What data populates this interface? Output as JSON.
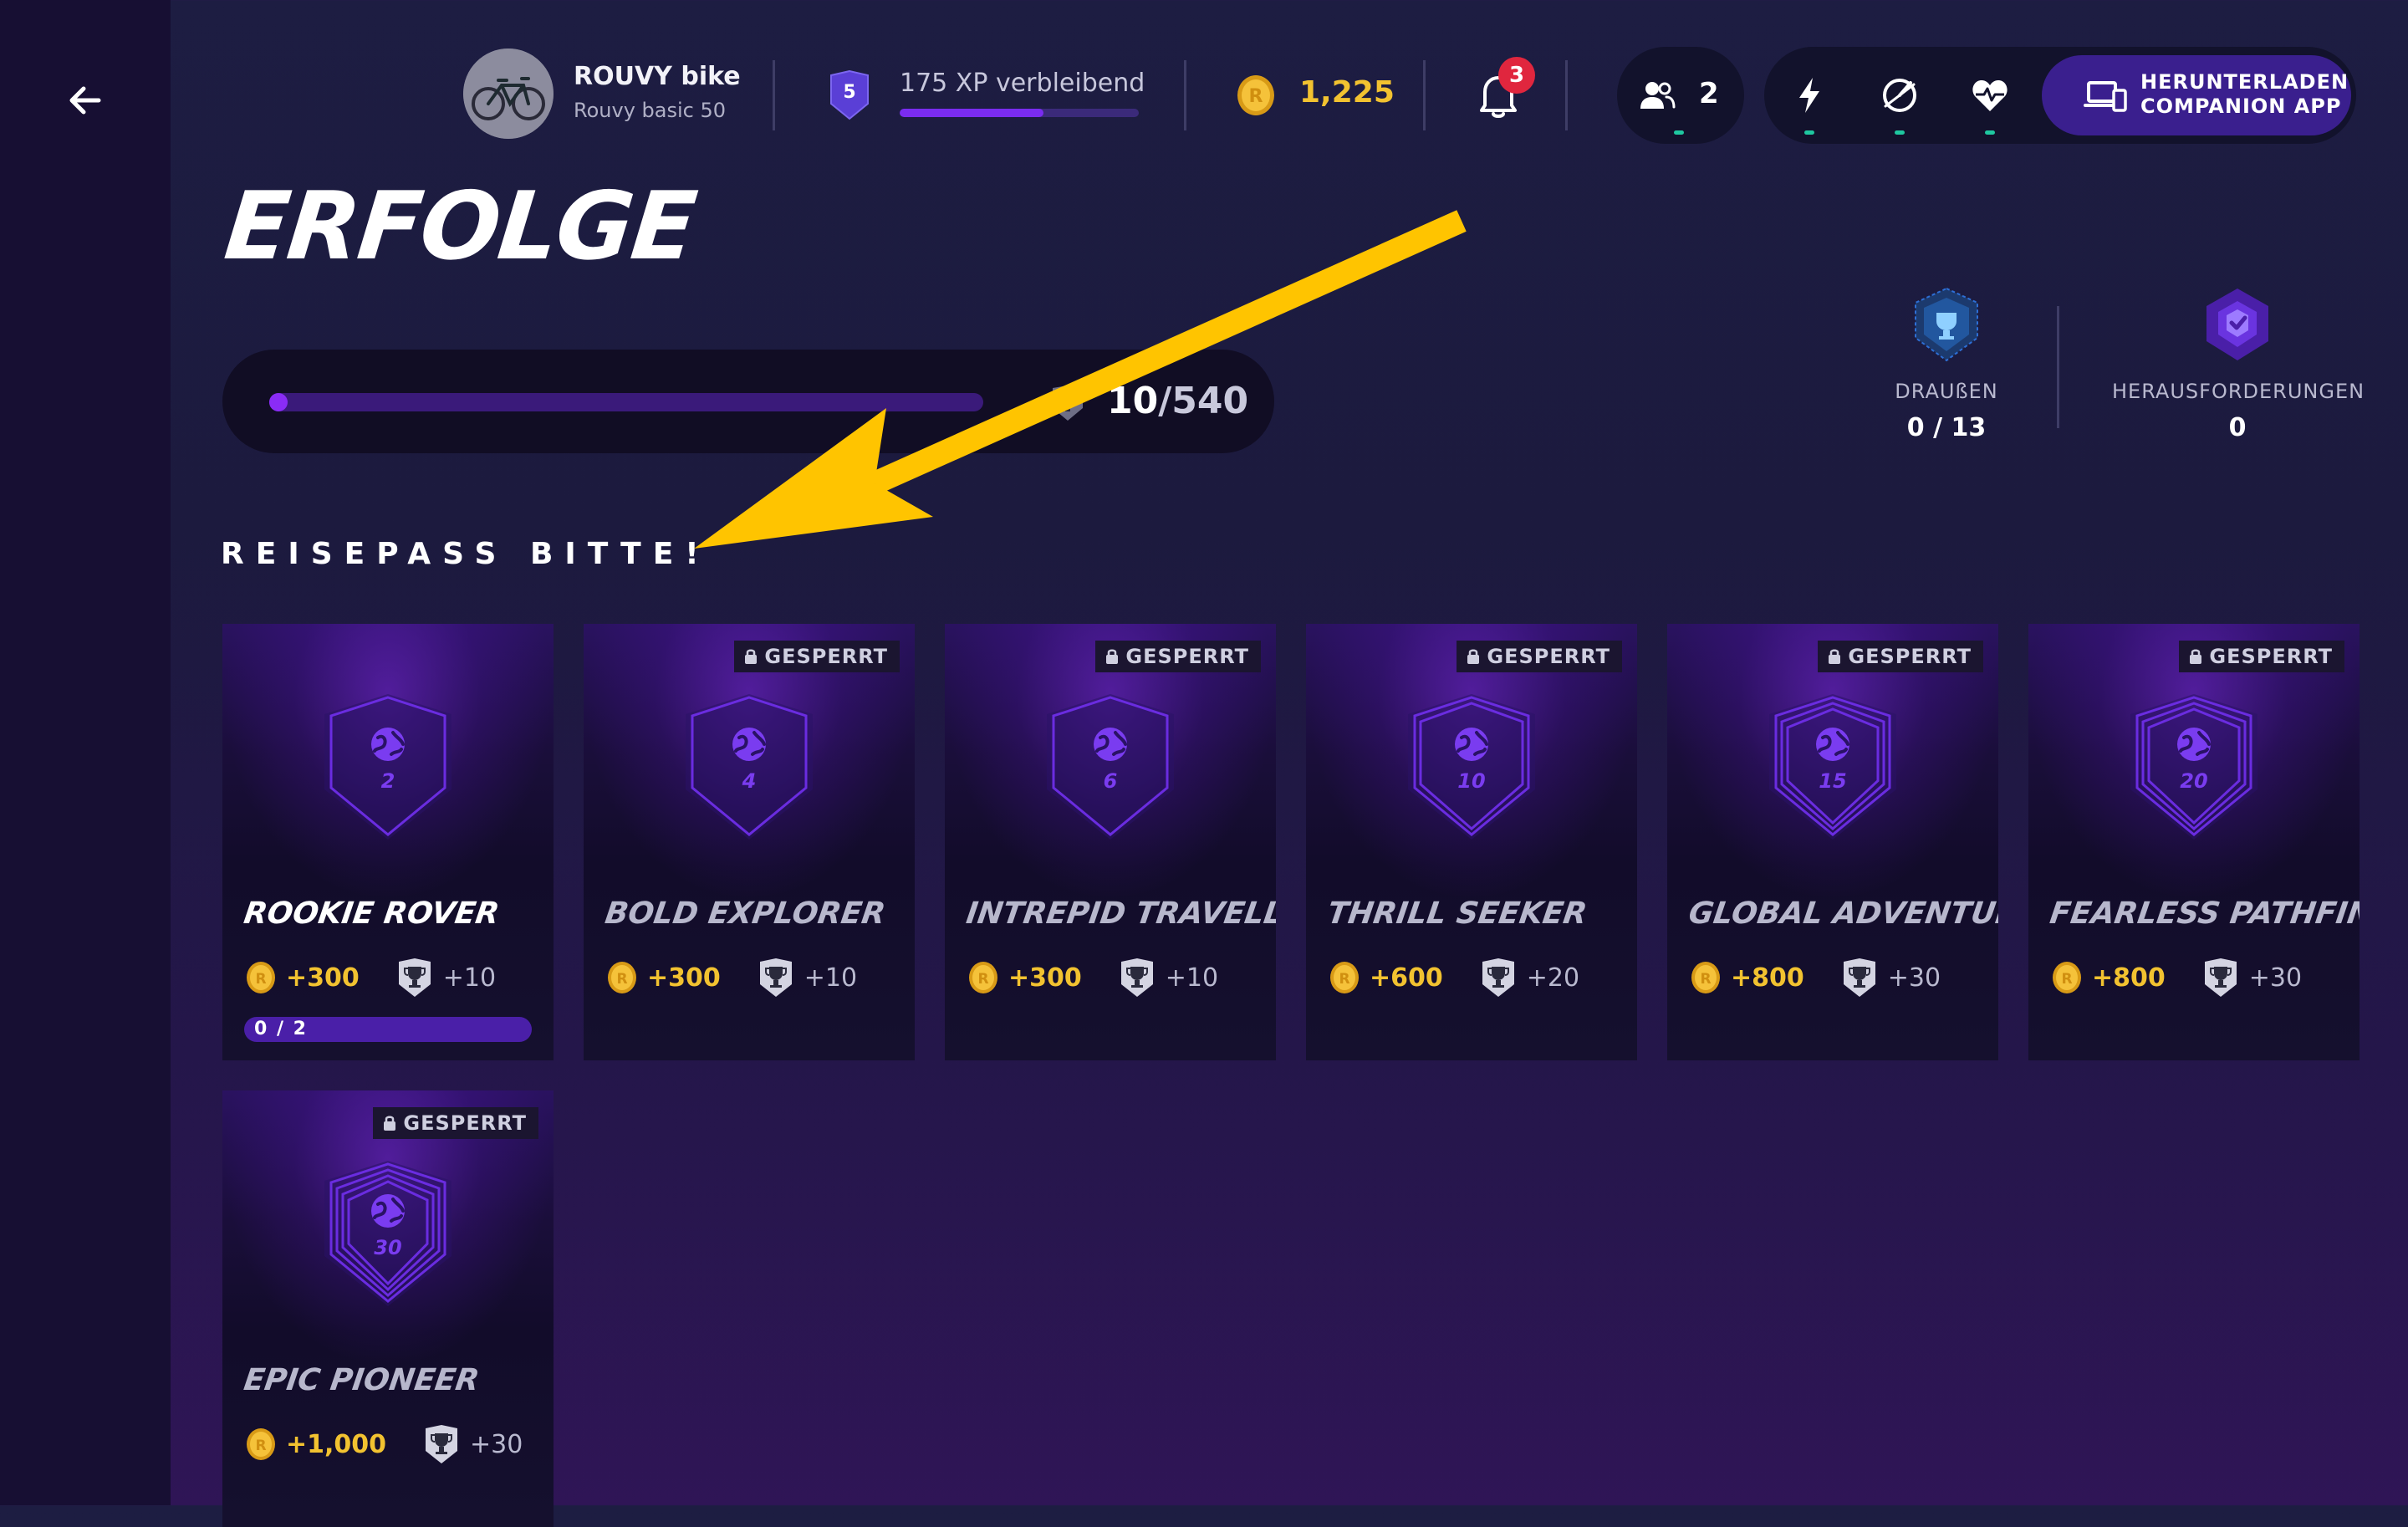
{
  "header": {
    "bike_name": "ROUVY bike",
    "bike_model": "Rouvy basic 50",
    "level": "5",
    "xp_text": "175 XP verbleibend",
    "xp_progress_percent": 60,
    "coins": "1,225",
    "notifications_count": "3",
    "friends_count": "2",
    "download_line1": "HERUNTERLADEN",
    "download_line2": "COMPANION APP"
  },
  "page": {
    "title": "ERFOLGE",
    "progress_current": "10",
    "progress_total": "/540",
    "progress_fraction": 0.0185
  },
  "stats": [
    {
      "label": "DRAUßEN",
      "value": "0 / 13"
    },
    {
      "label": "HERAUSFORDERUNGEN",
      "value": "0"
    }
  ],
  "section": {
    "title": "REISEPASS BITTE!"
  },
  "lock_label": "GESPERRT",
  "cards": [
    {
      "name": "ROOKIE ROVER",
      "badge_number": "2",
      "coins": "+300",
      "trophies": "+10",
      "locked": false,
      "progress": "0 / 2"
    },
    {
      "name": "BOLD EXPLORER",
      "badge_number": "4",
      "coins": "+300",
      "trophies": "+10",
      "locked": true
    },
    {
      "name": "INTREPID TRAVELLER",
      "badge_number": "6",
      "coins": "+300",
      "trophies": "+10",
      "locked": true
    },
    {
      "name": "THRILL SEEKER",
      "badge_number": "10",
      "coins": "+600",
      "trophies": "+20",
      "locked": true
    },
    {
      "name": "GLOBAL ADVENTURER",
      "badge_number": "15",
      "coins": "+800",
      "trophies": "+30",
      "locked": true
    },
    {
      "name": "FEARLESS PATHFINDER",
      "badge_number": "20",
      "coins": "+800",
      "trophies": "+30",
      "locked": true
    },
    {
      "name": "EPIC PIONEER",
      "badge_number": "30",
      "coins": "+1,000",
      "trophies": "+30",
      "locked": true
    }
  ],
  "colors": {
    "accent": "#7a2cf0",
    "coin": "#f2c230",
    "notification": "#e0263e",
    "arrow": "#ffc400"
  }
}
